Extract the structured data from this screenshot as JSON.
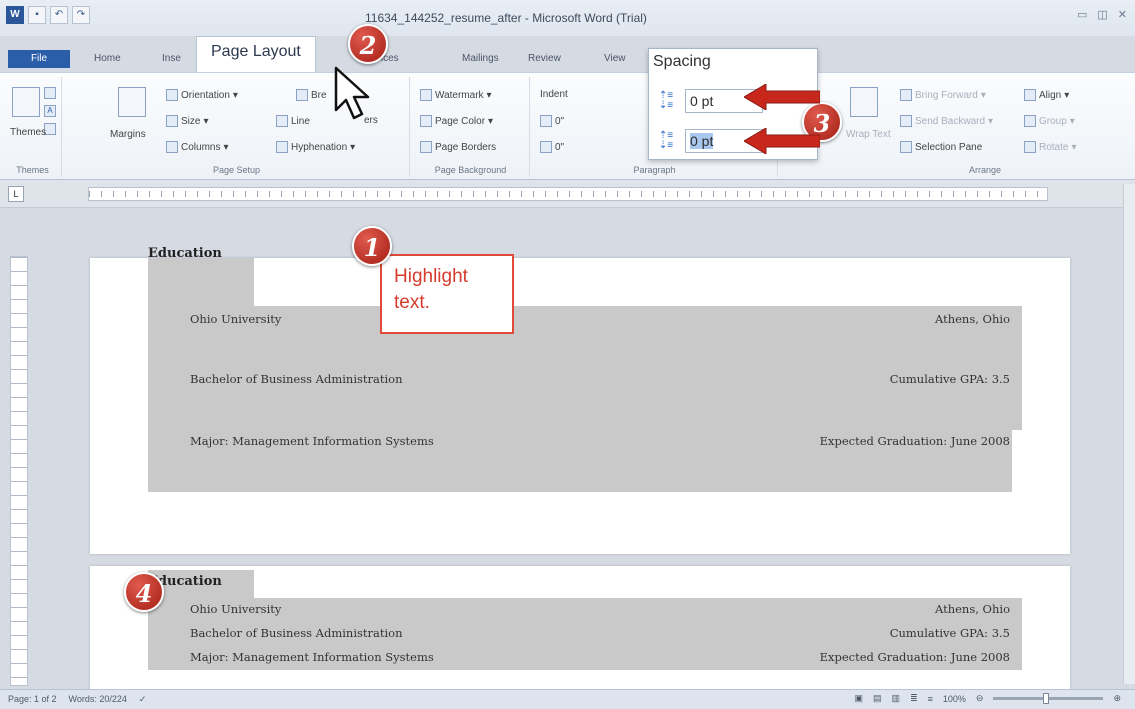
{
  "window": {
    "title": "11634_144252_resume_after - Microsoft Word (Trial)",
    "qat_icons": [
      "word-icon",
      "save-icon",
      "undo-icon",
      "redo-icon"
    ]
  },
  "tabs": {
    "file": "File",
    "home": "Home",
    "insert": "Inse",
    "page_layout": "Page Layout",
    "references": "ences",
    "mailings": "Mailings",
    "review": "Review",
    "view": "View"
  },
  "ribbon": {
    "themes": {
      "label": "Themes",
      "group": "Themes"
    },
    "page_setup": {
      "group": "Page Setup",
      "margins": "Margins",
      "orientation": "Orientation",
      "size": "Size",
      "columns": "Columns",
      "breaks": "Bre",
      "line_numbers": "Line",
      "line_numbers_suffix": "ers",
      "hyphenation": "Hyphenation"
    },
    "page_background": {
      "group": "Page Background",
      "watermark": "Watermark",
      "page_color": "Page Color",
      "page_borders": "Page Borders"
    },
    "paragraph": {
      "group": "Paragraph",
      "indent": "Indent",
      "indent_left": "0\"",
      "indent_right": "0\""
    },
    "spacing": {
      "title": "Spacing",
      "before": "0 pt",
      "after": "0 pt"
    },
    "arrange": {
      "group": "Arrange",
      "wrap_text": "Wrap Text",
      "bring_forward": "Bring Forward",
      "send_backward": "Send Backward",
      "selection_pane": "Selection Pane",
      "align": "Align",
      "group_btn": "Group",
      "rotate": "Rotate"
    }
  },
  "document": {
    "page1": {
      "heading": "Education",
      "rows": [
        {
          "left": "Ohio University",
          "right": "Athens, Ohio"
        },
        {
          "left": "Bachelor of Business Administration",
          "right": "Cumulative GPA: 3.5"
        },
        {
          "left": "Major: Management Information Systems",
          "right": "Expected Graduation: June 2008"
        }
      ]
    },
    "page2": {
      "heading": "Education",
      "rows": [
        {
          "left": "Ohio University",
          "right": "Athens, Ohio"
        },
        {
          "left": "Bachelor of Business Administration",
          "right": "Cumulative GPA: 3.5"
        },
        {
          "left": "Major: Management Information Systems",
          "right": "Expected Graduation: June 2008"
        }
      ]
    }
  },
  "annotations": {
    "callout_text": "Highlight text.",
    "step1": "1",
    "step2": "2",
    "step3": "3",
    "step4": "4",
    "accent_color": "#d63b2d"
  },
  "statusbar": {
    "page": "Page: 1 of 2",
    "words": "Words: 20/224",
    "zoom": "100%"
  }
}
